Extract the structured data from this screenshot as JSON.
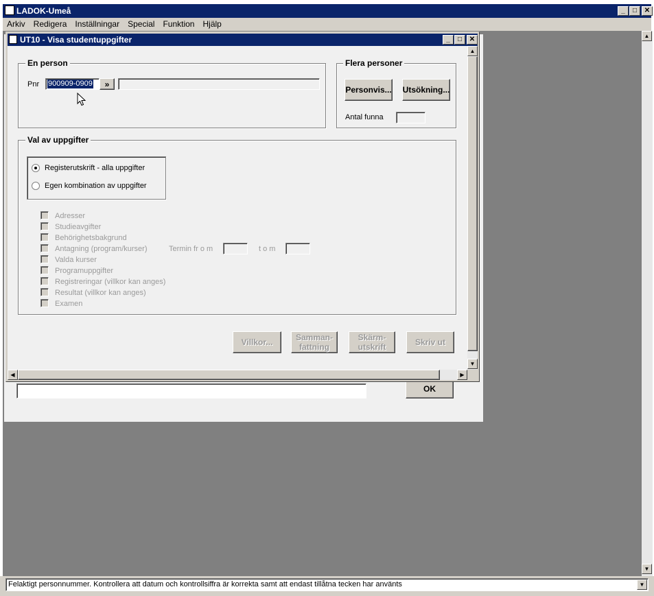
{
  "app": {
    "title": "LADOK-Umeå"
  },
  "menu": [
    "Arkiv",
    "Redigera",
    "Inställningar",
    "Special",
    "Funktion",
    "Hjälp"
  ],
  "child": {
    "title": "UT10 - Visa studentuppgifter",
    "en_person": {
      "legend": "En person",
      "pnr_label": "Pnr",
      "pnr_value": "900909-0909",
      "go_label": "»",
      "name_value": ""
    },
    "flera": {
      "legend": "Flera personer",
      "personvis_label": "Personvis...",
      "utsokning_label": "Utsökning...",
      "antal_label": "Antal funna",
      "antal_value": ""
    },
    "val": {
      "legend": "Val av uppgifter",
      "radios": [
        {
          "label": "Registerutskrift - alla uppgifter",
          "checked": true
        },
        {
          "label": "Egen kombination av uppgifter",
          "checked": false
        }
      ],
      "checkboxes": [
        "Adresser",
        "Studieavgifter",
        "Behörighetsbakgrund",
        "Antagning (program/kurser)",
        "Valda kurser",
        "Programuppgifter",
        "Registreringar (villkor kan anges)",
        "Resultat (villkor kan anges)",
        "Examen"
      ],
      "termin_from_label": "Termin fr o m",
      "termin_tom_label": "t o m"
    },
    "buttons": {
      "villkor": "Villkor...",
      "sammanfattning": "Samman-\nfattning",
      "skarmutskrift": "Skärm-\nutskrift",
      "skriv_ut": "Skriv ut"
    }
  },
  "background_dialog": {
    "ok_label": "OK"
  },
  "status": {
    "message": "Felaktigt personnummer. Kontrollera att datum och kontrollsiffra är korrekta samt att endast tillåtna tecken har använts"
  },
  "colors": {
    "titlebar": "#0a246a",
    "mdi_background": "#808080",
    "face": "#d4d0c8",
    "dialog_bg": "#f0f0f0"
  }
}
